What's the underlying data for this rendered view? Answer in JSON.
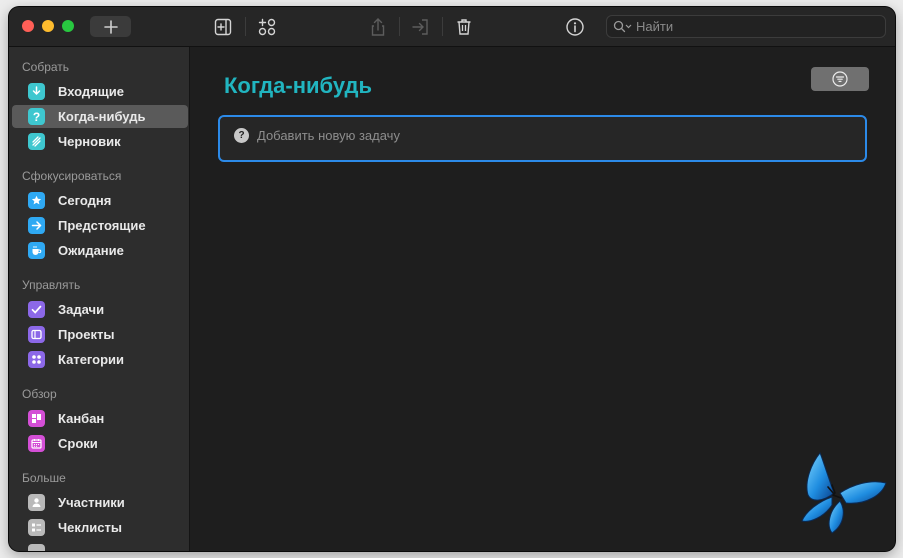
{
  "toolbar": {
    "search_placeholder": "Найти"
  },
  "sidebar": {
    "sections": [
      {
        "label": "Собрать",
        "items": [
          {
            "label": "Входящие",
            "icon": "inbox-icon",
            "color": "#3ec7cf"
          },
          {
            "label": "Когда-нибудь",
            "icon": "question-icon",
            "color": "#3ec7cf",
            "active": true
          },
          {
            "label": "Черновик",
            "icon": "sketch-icon",
            "color": "#3ec7cf"
          }
        ]
      },
      {
        "label": "Сфокусироваться",
        "items": [
          {
            "label": "Сегодня",
            "icon": "star-icon",
            "color": "#2fa9f3"
          },
          {
            "label": "Предстоящие",
            "icon": "arrow-right-icon",
            "color": "#2fa9f3"
          },
          {
            "label": "Ожидание",
            "icon": "cup-icon",
            "color": "#2fa9f3"
          }
        ]
      },
      {
        "label": "Управлять",
        "items": [
          {
            "label": "Задачи",
            "icon": "checkmark-icon",
            "color": "#8c68e8"
          },
          {
            "label": "Проекты",
            "icon": "project-icon",
            "color": "#8c68e8"
          },
          {
            "label": "Категории",
            "icon": "categories-icon",
            "color": "#8c68e8"
          }
        ]
      },
      {
        "label": "Обзор",
        "items": [
          {
            "label": "Канбан",
            "icon": "kanban-icon",
            "color": "#d44fd6"
          },
          {
            "label": "Сроки",
            "icon": "calendar-icon",
            "color": "#d44fd6"
          }
        ]
      },
      {
        "label": "Больше",
        "items": [
          {
            "label": "Участники",
            "icon": "person-icon",
            "color": "#b9b9b9"
          },
          {
            "label": "Чеклисты",
            "icon": "checklist-icon",
            "color": "#b9b9b9"
          }
        ]
      }
    ]
  },
  "main": {
    "title": "Когда-нибудь",
    "new_task_placeholder": "Добавить новую задачу",
    "new_task_badge": "?"
  },
  "colors": {
    "accent_title": "#21b5c0",
    "focus_border": "#2c8ae8"
  }
}
